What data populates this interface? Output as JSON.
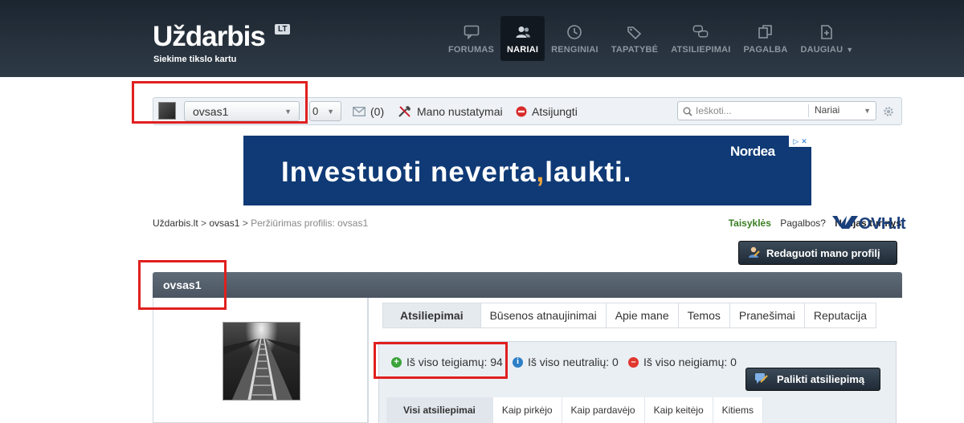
{
  "brand": {
    "name": "Uždarbis",
    "badge": "LT",
    "tagline": "Siekime tikslo kartu"
  },
  "nav": [
    {
      "label": "FORUMAS",
      "icon": "speech-bubble-icon",
      "active": false
    },
    {
      "label": "NARIAI",
      "icon": "users-icon",
      "active": true
    },
    {
      "label": "RENGINIAI",
      "icon": "clock-icon",
      "active": false
    },
    {
      "label": "TAPATYBĖ",
      "icon": "tag-icon",
      "active": false
    },
    {
      "label": "ATSILIEPIMAI",
      "icon": "chat-bubbles-icon",
      "active": false
    },
    {
      "label": "PAGALBA",
      "icon": "copy-icon",
      "active": false
    },
    {
      "label": "DAUGIAU",
      "icon": "add-page-icon",
      "active": false
    }
  ],
  "userbar": {
    "username": "ovsas1",
    "notifications": "0",
    "messages_count": "(0)",
    "settings_label": "Mano nustatymai",
    "logout_label": "Atsijungti",
    "search_placeholder": "Ieškoti...",
    "search_scope": "Nariai"
  },
  "ad": {
    "text_before": "Investuoti  neverta",
    "comma": ",",
    "text_after": "laukti.",
    "brand": "Nordea"
  },
  "breadcrumb": {
    "home": "Uždarbis.lt",
    "sep1": " > ",
    "user": "ovsas1",
    "sep2": " > ",
    "current": "Peržiūrimas profilis: ovsas1"
  },
  "toplinks": {
    "rules": "Taisyklės",
    "help": "Pagalbos?",
    "new_content": "Naujas turinys",
    "sponsor": "OVH.lt"
  },
  "profile": {
    "edit_button": "Redaguoti mano profilį",
    "title": "ovsas1"
  },
  "tabs": [
    "Atsiliepimai",
    "Būsenos atnaujinimai",
    "Apie mane",
    "Temos",
    "Pranešimai",
    "Reputacija"
  ],
  "feedback": {
    "positive": "Iš viso teigiamų: 94",
    "neutral": "Iš viso neutralių: 0",
    "negative": "Iš viso neigiamų: 0",
    "leave_button": "Palikti atsiliepimą"
  },
  "subtabs": [
    "Visi atsiliepimai",
    "Kaip pirkėjo",
    "Kaip pardavėjo",
    "Kaip keitėjo",
    "Kitiems"
  ],
  "colors": {
    "header_bg": "#1b2530",
    "positive": "#3aa43a",
    "neutral": "#2c7fc6",
    "negative": "#e0372f",
    "annotation": "#e0201f"
  }
}
